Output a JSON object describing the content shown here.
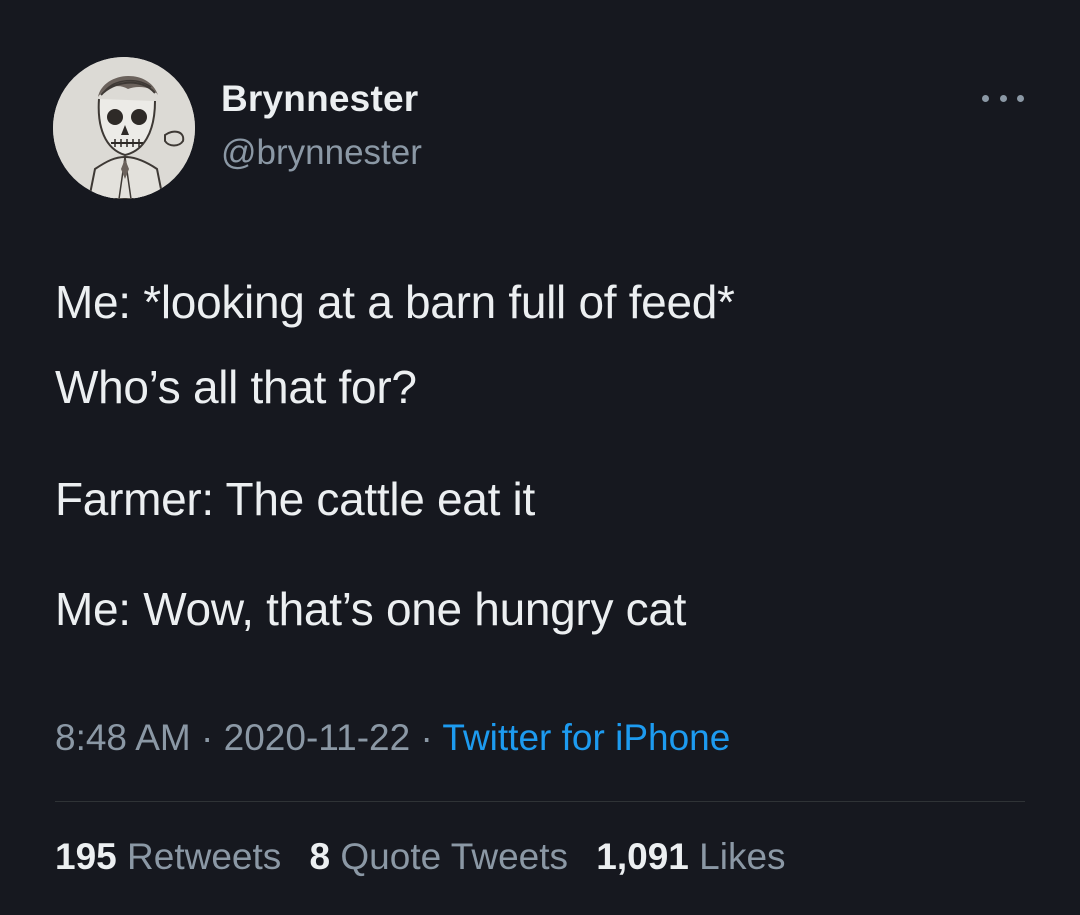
{
  "user": {
    "display_name": "Brynnester",
    "handle": "@brynnester"
  },
  "tweet": {
    "lines": [
      "Me: *looking at a barn full of feed*",
      "Who’s all that for?",
      "Farmer: The cattle eat it",
      "Me: Wow, that’s one hungry cat"
    ],
    "time": "8:48 AM",
    "date": "2020-11-22",
    "separator": " · ",
    "source": "Twitter for iPhone"
  },
  "stats": {
    "retweets_count": "195",
    "retweets_label": "Retweets",
    "quote_count": "8",
    "quote_label": "Quote Tweets",
    "likes_count": "1,091",
    "likes_label": "Likes"
  },
  "colors": {
    "background": "#16181f",
    "text": "#eceff1",
    "secondary": "#8b98a5",
    "accent": "#1d9bf0"
  },
  "icons": {
    "more": "more-horizontal-icon",
    "avatar": "skull-portrait-sketch"
  }
}
